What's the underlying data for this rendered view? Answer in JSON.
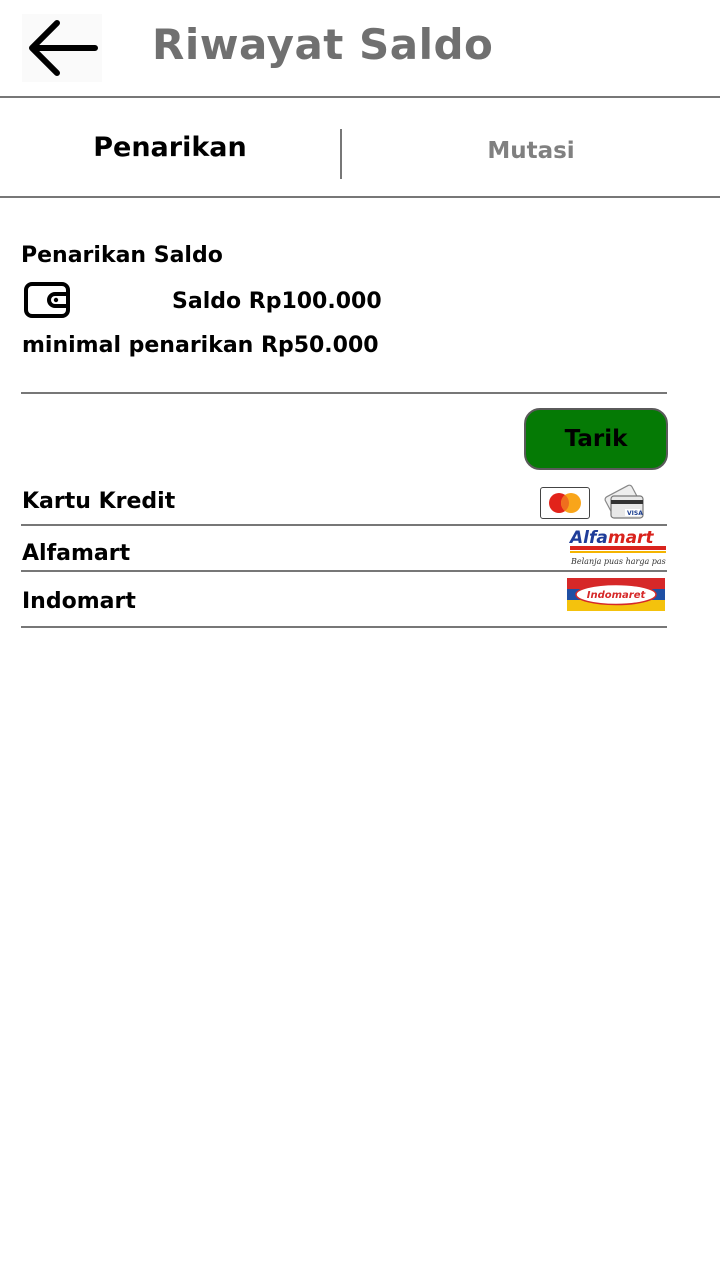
{
  "header": {
    "title": "Riwayat Saldo",
    "back_icon": "arrow-left-icon"
  },
  "tabs": [
    {
      "label": "Penarikan",
      "active": true
    },
    {
      "label": "Mutasi",
      "active": false
    }
  ],
  "withdrawal": {
    "section_title": "Penarikan Saldo",
    "wallet_icon": "wallet-icon",
    "balance_text": "Saldo Rp100.000",
    "minimum_text": "minimal penarikan Rp50.000",
    "withdraw_button": "Tarik"
  },
  "methods": [
    {
      "label": "Kartu Kredit",
      "logos": [
        "mastercard-logo",
        "visa-card-icon"
      ]
    },
    {
      "label": "Alfamart",
      "logo": "alfamart-logo",
      "logo_text": "Alfamart",
      "tagline": "Belanja puas harga pas"
    },
    {
      "label": "Indomart",
      "logo": "indomaret-logo",
      "logo_text": "Indomaret"
    }
  ],
  "colors": {
    "title_gray": "#707070",
    "inactive_tab": "#808080",
    "button_green": "#057a05",
    "divider": "#777777"
  }
}
